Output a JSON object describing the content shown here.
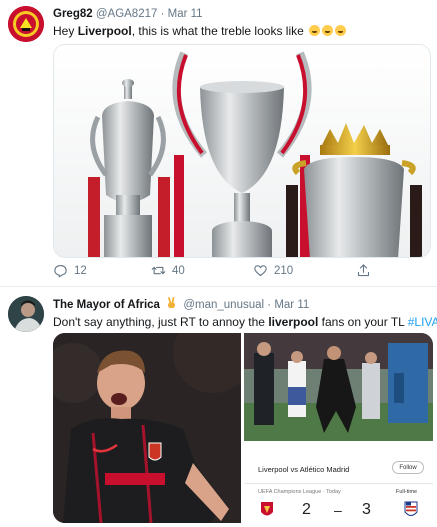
{
  "tweets": [
    {
      "name": "Greg82",
      "handle": "@AGA8217",
      "dot": "·",
      "time": "Mar 11",
      "text_before": "Hey ",
      "text_bold": "Liverpool",
      "text_after": ", this is what the treble looks like",
      "emoji": [
        "joy-emoji",
        "joy-emoji",
        "joy-emoji"
      ],
      "replies": "12",
      "retweets": "40",
      "likes": "210"
    },
    {
      "name": "The Mayor of Africa",
      "handle": "@man_unusual",
      "dot": "·",
      "time": "Mar 11",
      "text_before": "Don't say anything, just RT to annoy the ",
      "text_bold": "liverpool",
      "text_after": " fans on your TL ",
      "hashtag": "#LIVATL"
    }
  ],
  "score_card": {
    "title": "Liverpool vs Atlético Madrid",
    "follow_label": "Follow",
    "competition": "UEFA Champions League · Today",
    "status": "Full-time",
    "home_score": "2",
    "separator": "–",
    "away_score": "3"
  },
  "colors": {
    "accent": "#1da1f2",
    "muted": "#657786",
    "text": "#14171a"
  }
}
